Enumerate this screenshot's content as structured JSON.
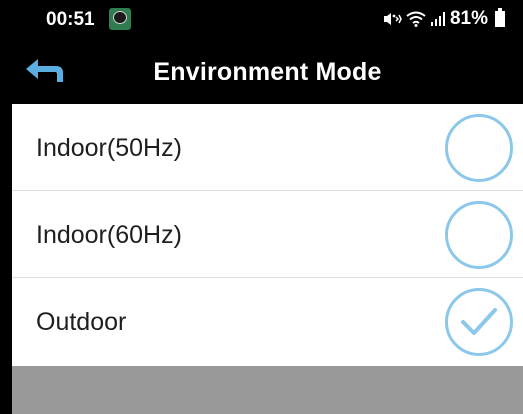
{
  "status_bar": {
    "time": "00:51",
    "battery_text": "81%",
    "icons": [
      "app-notification-icon",
      "mute-vibrate-icon",
      "wifi-icon",
      "signal-icon",
      "battery-icon"
    ]
  },
  "app_bar": {
    "title": "Environment Mode",
    "back_icon": "back-arrow-icon"
  },
  "options": [
    {
      "label": "Indoor(50Hz)",
      "selected": false
    },
    {
      "label": "Indoor(60Hz)",
      "selected": false
    },
    {
      "label": "Outdoor",
      "selected": true
    }
  ],
  "colors": {
    "header_background": "#000000",
    "accent_radio": "#8cc8ea",
    "footer_bar": "#999999"
  }
}
